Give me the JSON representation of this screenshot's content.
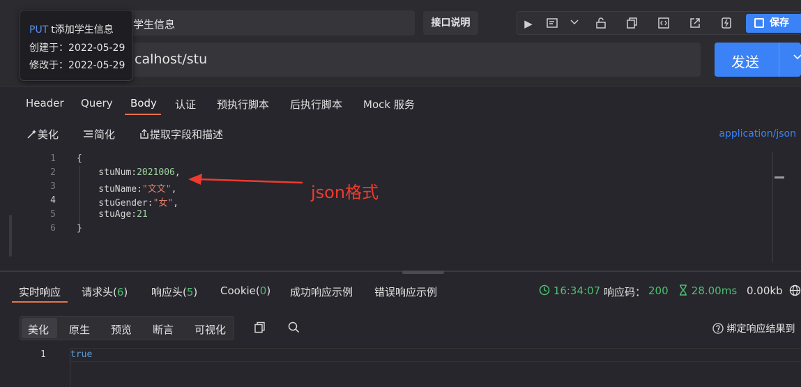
{
  "request": {
    "name": "学生信息",
    "doc_button": "接口说明",
    "url": "calhost/stu",
    "send_label": "发送",
    "save_label": "保存"
  },
  "toolbar_icons": [
    "play-icon",
    "doc-icon",
    "chevron-down-icon",
    "unlock-icon",
    "copy-icon",
    "code-icon",
    "share-icon",
    "flash-icon",
    "save-icon"
  ],
  "tooltip": {
    "method": "PUT",
    "title": "t添加学生信息",
    "created": "创建于：2022-05-29",
    "modified": "修改于：2022-05-29"
  },
  "request_tabs": [
    "Header",
    "Query",
    "Body",
    "认证",
    "预执行脚本",
    "后执行脚本",
    "Mock 服务"
  ],
  "active_request_tab": "Body",
  "body_tools": {
    "beautify": "美化",
    "simplify": "简化",
    "extract": "提取字段和描述",
    "content_type": "application/json"
  },
  "editor": {
    "line_numbers": [
      "1",
      "2",
      "3",
      "4",
      "5",
      "6"
    ],
    "lines": [
      {
        "a": "{",
        "b": "",
        "c": ""
      },
      {
        "a": "    stuNum:",
        "b": "2021006",
        "c": ","
      },
      {
        "a": "    stuName:",
        "b": "\"文文\"",
        "c": ","
      },
      {
        "a": "    stuGender:",
        "b": "\"女\"",
        "c": ","
      },
      {
        "a": "    stuAge:",
        "b": "21",
        "c": ""
      },
      {
        "a": "}",
        "b": "",
        "c": ""
      }
    ]
  },
  "annotation": {
    "text": "json格式",
    "color": "#f03a2e"
  },
  "response_tabs": {
    "realtime": "实时响应",
    "req_headers": "请求头(",
    "req_headers_count": "6",
    "resp_headers": "响应头(",
    "resp_headers_count": "5",
    "cookie": "Cookie(",
    "cookie_count": "0",
    "close_paren": ")",
    "success_example": "成功响应示例",
    "error_example": "错误响应示例"
  },
  "response_stats": {
    "time": "16:34:07",
    "code_label": "响应码：",
    "code": "200",
    "duration": "28.00ms",
    "size": "0.00kb"
  },
  "view_modes": [
    "美化",
    "原生",
    "预览",
    "断言",
    "可视化"
  ],
  "bind_result_label": "绑定响应结果到",
  "response_body": {
    "line_number": "1",
    "value": "true"
  },
  "colors": {
    "accent_blue": "#3b82f6",
    "tab_underline": "#e8734a",
    "success_green": "#4fbf71"
  }
}
